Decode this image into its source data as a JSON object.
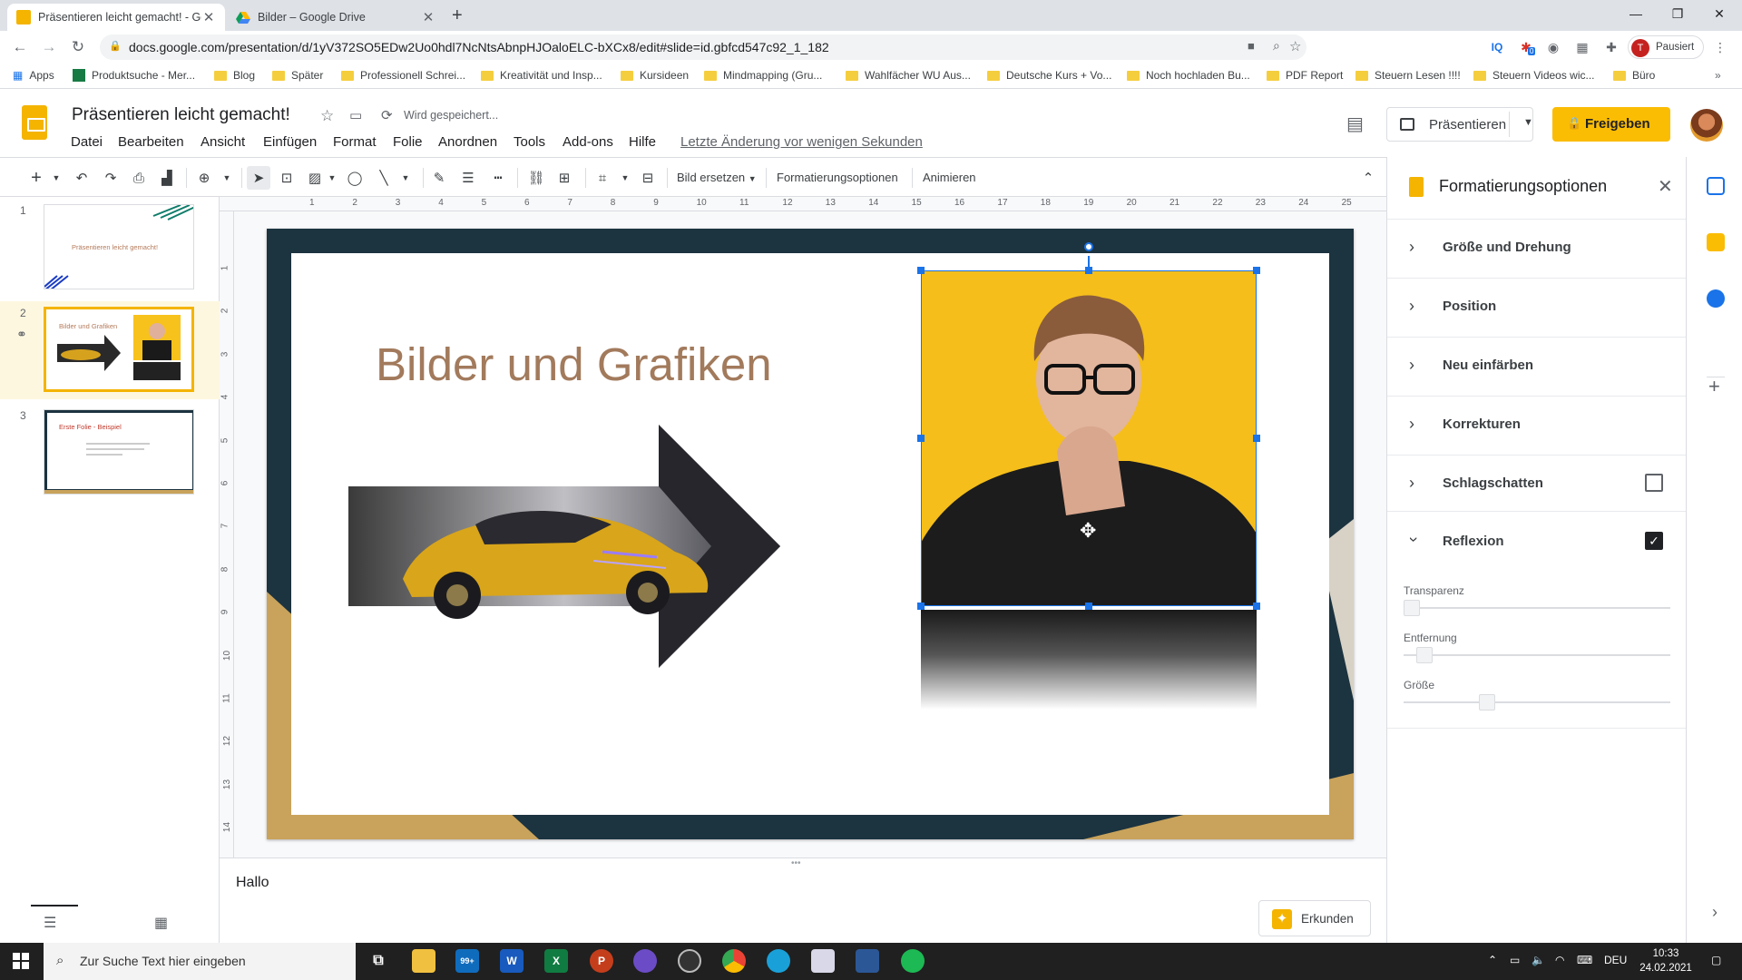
{
  "browser": {
    "tabs": [
      {
        "title": "Präsentieren leicht gemacht! - Goo",
        "active": true
      },
      {
        "title": "Bilder – Google Drive",
        "active": false
      }
    ],
    "url": "docs.google.com/presentation/d/1yV372SO5EDw2Uo0hdl7NcNtsAbnpHJOaloELC-bXCx8/edit#slide=id.gbfcd547c92_1_182",
    "profile_label": "Pausiert",
    "profile_initial": "T",
    "ext_badge": "0"
  },
  "bookmarks": [
    {
      "label": "Apps",
      "type": "apps"
    },
    {
      "label": "Produktsuche - Mer...",
      "type": "site"
    },
    {
      "label": "Blog",
      "type": "folder"
    },
    {
      "label": "Später",
      "type": "folder"
    },
    {
      "label": "Professionell Schrei...",
      "type": "folder"
    },
    {
      "label": "Kreativität und Insp...",
      "type": "folder"
    },
    {
      "label": "Kursideen",
      "type": "folder"
    },
    {
      "label": "Mindmapping  (Gru...",
      "type": "folder"
    },
    {
      "label": "Wahlfächer WU Aus...",
      "type": "folder"
    },
    {
      "label": "Deutsche Kurs + Vo...",
      "type": "folder"
    },
    {
      "label": "Noch hochladen Bu...",
      "type": "folder"
    },
    {
      "label": "PDF Report",
      "type": "folder"
    },
    {
      "label": "Steuern Lesen !!!!",
      "type": "folder"
    },
    {
      "label": "Steuern Videos wic...",
      "type": "folder"
    },
    {
      "label": "Büro",
      "type": "folder"
    }
  ],
  "doc": {
    "title": "Präsentieren leicht gemacht!",
    "save_status": "Wird gespeichert...",
    "menus": [
      "Datei",
      "Bearbeiten",
      "Ansicht",
      "Einfügen",
      "Format",
      "Folie",
      "Anordnen",
      "Tools",
      "Add-ons",
      "Hilfe"
    ],
    "last_edit": "Letzte Änderung vor wenigen Sekunden",
    "present_label": "Präsentieren",
    "share_label": "Freigeben"
  },
  "toolbar": {
    "replace_image": "Bild ersetzen",
    "format_options": "Formatierungsoptionen",
    "animate": "Animieren"
  },
  "ruler": {
    "top": [
      "1",
      "2",
      "3",
      "4",
      "5",
      "6",
      "7",
      "8",
      "9",
      "10",
      "11",
      "12",
      "13",
      "14",
      "15",
      "16",
      "17",
      "18",
      "19",
      "20",
      "21",
      "22",
      "23",
      "24",
      "25"
    ],
    "left": [
      "1",
      "2",
      "3",
      "4",
      "5",
      "6",
      "7",
      "8",
      "9",
      "10",
      "11",
      "12",
      "13",
      "14"
    ]
  },
  "filmstrip": {
    "slides": [
      {
        "num": "1",
        "title": "Präsentieren leicht gemacht!"
      },
      {
        "num": "2",
        "title": "Bilder und Grafiken"
      },
      {
        "num": "3",
        "title": "Erste Folie - Beispiel"
      }
    ]
  },
  "slide": {
    "title": "Bilder und Grafiken"
  },
  "notes": {
    "text": "Hallo",
    "explore_label": "Erkunden"
  },
  "format_panel": {
    "title": "Formatierungsoptionen",
    "sections": [
      {
        "label": "Größe und Drehung",
        "expanded": false
      },
      {
        "label": "Position",
        "expanded": false
      },
      {
        "label": "Neu einfärben",
        "expanded": false
      },
      {
        "label": "Korrekturen",
        "expanded": false
      },
      {
        "label": "Schlagschatten",
        "expanded": false,
        "checked": false
      },
      {
        "label": "Reflexion",
        "expanded": true,
        "checked": true
      }
    ],
    "sliders": [
      {
        "label": "Transparenz",
        "value": 0.0
      },
      {
        "label": "Entfernung",
        "value": 0.05
      },
      {
        "label": "Größe",
        "value": 0.3
      }
    ]
  },
  "taskbar": {
    "search_placeholder": "Zur Suche Text hier eingeben",
    "mail_badge": "99+",
    "lang": "DEU",
    "time": "10:33",
    "date": "24.02.2021"
  },
  "colors": {
    "accent_yellow": "#fbbc04",
    "slide_dark": "#1c3340",
    "slide_title": "#a27a5c",
    "selection_blue": "#1a73e8"
  }
}
